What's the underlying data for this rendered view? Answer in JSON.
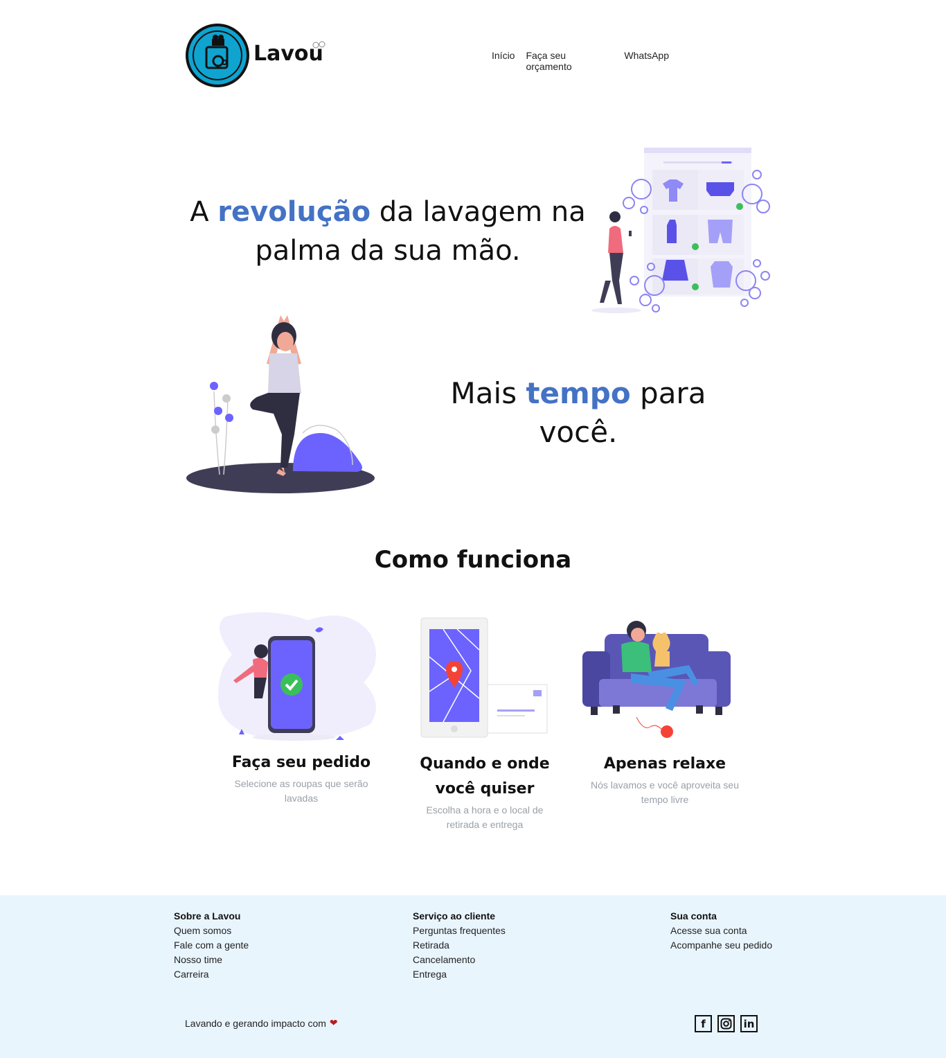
{
  "header": {
    "logo_text": "Lavou",
    "nav": [
      "Início",
      "Faça seu orçamento",
      "WhatsApp"
    ]
  },
  "hero": {
    "line1_prefix": "A ",
    "line1_accent": "revolução",
    "line1_suffix": " da lavagem na",
    "line2": "palma da sua mão.",
    "tagline_prefix": "Mais ",
    "tagline_accent": "tempo",
    "tagline_suffix": " para você."
  },
  "how": {
    "title": "Como funciona",
    "steps": [
      {
        "title": "Faça seu pedido",
        "desc": "Selecione as roupas que serão lavadas"
      },
      {
        "title": "Quando e onde você quiser",
        "desc": "Escolha a hora e o local de retirada e entrega"
      },
      {
        "title": "Apenas relaxe",
        "desc": "Nós lavamos e você aproveita seu tempo livre"
      }
    ]
  },
  "footer": {
    "columns": [
      {
        "heading": "Sobre a Lavou",
        "links": [
          "Quem somos",
          "Fale com a gente",
          "Nosso time",
          "Carreira"
        ]
      },
      {
        "heading": "Serviço ao cliente",
        "links": [
          "Perguntas frequentes",
          "Retirada",
          "Cancelamento",
          "Entrega"
        ]
      },
      {
        "heading": "Sua conta",
        "links": [
          "Acesse sua conta",
          "Acompanhe seu pedido"
        ]
      }
    ],
    "tagline": "Lavando e gerando impacto com",
    "heart_icon": "heart-icon",
    "social": [
      {
        "icon": "facebook-icon",
        "glyph": "f"
      },
      {
        "icon": "instagram-icon",
        "glyph": ""
      },
      {
        "icon": "linkedin-icon",
        "glyph": "in"
      }
    ]
  },
  "colors": {
    "accent": "#4472c4",
    "logo_ring": "#0fa3d0",
    "illustration_purple": "#6c63ff",
    "footer_bg": "#e9f5fd"
  }
}
